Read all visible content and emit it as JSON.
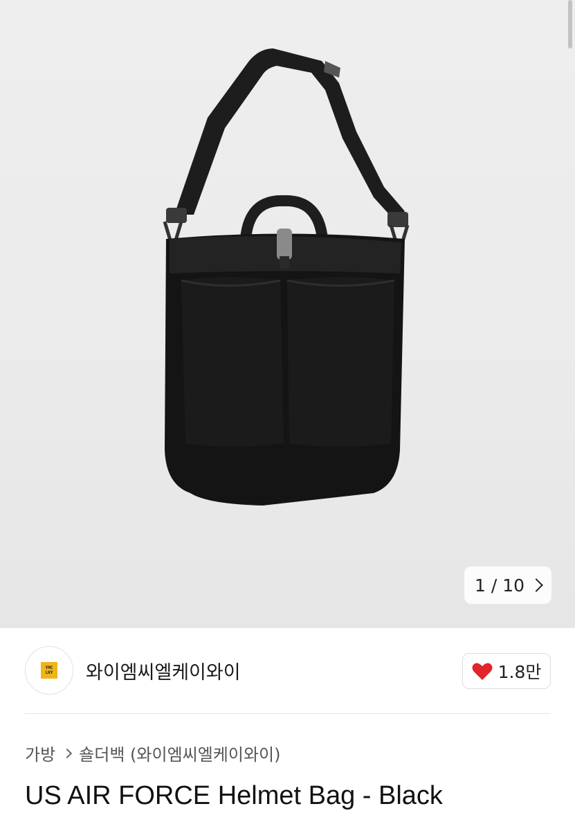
{
  "gallery": {
    "image_alt": "US AIR FORCE Helmet Bag - Black",
    "current": "1",
    "total": "10",
    "counter_text": "1 / 10"
  },
  "shop": {
    "name": "와이엠씨엘케이와이",
    "logo_text_line1": "YMC",
    "logo_text_line2": "LKY",
    "likes": "1.8만"
  },
  "breadcrumb": {
    "items": [
      "가방",
      "숄더백 (와이엠씨엘케이와이)"
    ]
  },
  "product": {
    "title": "US AIR FORCE Helmet Bag - Black"
  },
  "colors": {
    "heart": "#e0252b",
    "logo_bg": "#f0b418"
  }
}
